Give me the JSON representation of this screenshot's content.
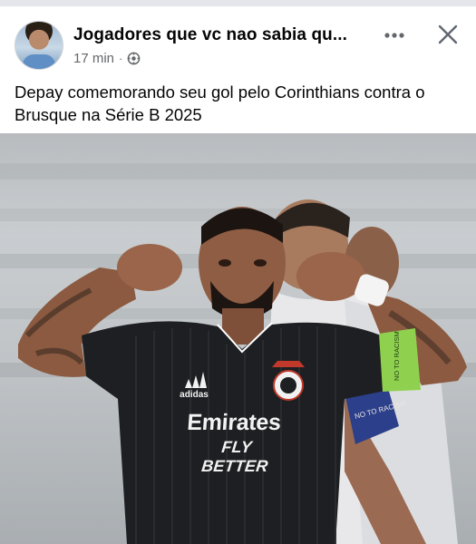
{
  "post": {
    "page_name": "Jogadores que vc nao sabia qu...",
    "timestamp": "17 min",
    "separator": "·",
    "privacy_icon": "globe-icon",
    "more_icon": "more-horizontal-icon",
    "close_icon": "close-icon",
    "caption": "Depay comemorando seu gol pelo Corinthians contra o Brusque na Série B 2025"
  },
  "photo": {
    "sponsor_main": "Emirates",
    "sponsor_sub": "FLY BETTER",
    "kit_brand": "adidas",
    "armband_text": "NO TO RACISM",
    "sleeve_badge": "NO TO RACISM"
  },
  "colors": {
    "text_primary": "#050505",
    "text_secondary": "#65676b",
    "jersey": "#1e1f22",
    "armband": "#8fd14f",
    "background": "#ffffff"
  }
}
